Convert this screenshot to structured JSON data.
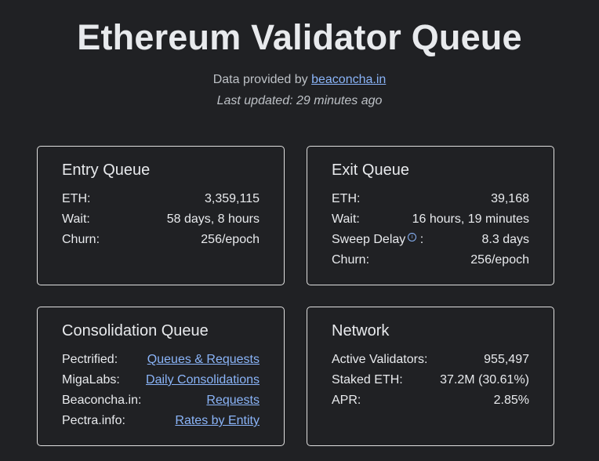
{
  "header": {
    "title": "Ethereum Validator Queue",
    "provided_prefix": "Data provided by ",
    "provider_link": "beaconcha.in",
    "last_updated": "Last updated: 29 minutes ago"
  },
  "entry_queue": {
    "title": "Entry Queue",
    "rows": [
      {
        "label": "ETH:",
        "value": "3,359,115"
      },
      {
        "label": "Wait:",
        "value": "58 days, 8 hours"
      },
      {
        "label": "Churn:",
        "value": "256/epoch"
      }
    ]
  },
  "exit_queue": {
    "title": "Exit Queue",
    "rows": [
      {
        "label": "ETH:",
        "value": "39,168"
      },
      {
        "label": "Wait:",
        "value": "16 hours, 19 minutes"
      },
      {
        "label": "Sweep Delay",
        "label_suffix": ":",
        "value": "8.3 days",
        "icon": "info-icon"
      },
      {
        "label": "Churn:",
        "value": "256/epoch"
      }
    ]
  },
  "consolidation_queue": {
    "title": "Consolidation Queue",
    "rows": [
      {
        "label": "Pectrified:",
        "link": "Queues & Requests"
      },
      {
        "label": "MigaLabs:",
        "link": "Daily Consolidations"
      },
      {
        "label": "Beaconcha.in:",
        "link": "Requests"
      },
      {
        "label": "Pectra.info:",
        "link": "Rates by Entity"
      }
    ]
  },
  "network": {
    "title": "Network",
    "rows": [
      {
        "label": "Active Validators:",
        "value": "955,497"
      },
      {
        "label": "Staked ETH:",
        "value": "37.2M (30.61%)"
      },
      {
        "label": "APR:",
        "value": "2.85%"
      }
    ]
  },
  "colors": {
    "background": "#202124",
    "text": "#e8eaed",
    "muted": "#bdc1c6",
    "link": "#8ab4f8",
    "card_border": "#e0e0e0"
  }
}
